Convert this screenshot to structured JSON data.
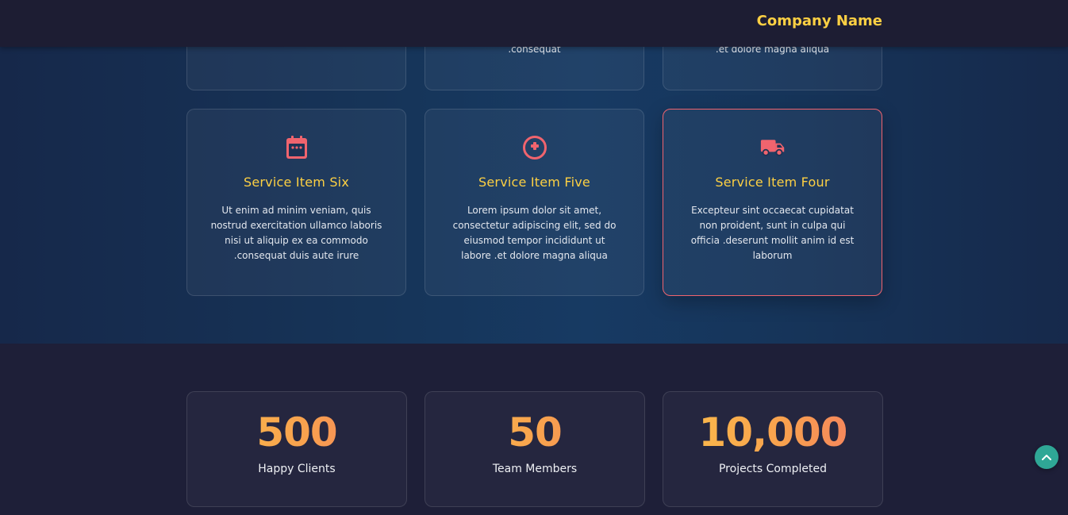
{
  "header": {
    "brand": "Company Name"
  },
  "services_top_partial": [
    {
      "desc_tail": ""
    },
    {
      "desc_tail": ".consequat"
    },
    {
      "desc_tail": ".et dolore magna aliqua"
    }
  ],
  "services": [
    {
      "icon": "calendar-icon",
      "title": "Service Item Six",
      "description": "Ut enim ad minim veniam, quis nostrud exercitation ullamco laboris nisi ut aliquip ex ea commodo .consequat duis aute irure"
    },
    {
      "icon": "plus-circle-icon",
      "title": "Service Item Five",
      "description": "Lorem ipsum dolor sit amet, consectetur adipiscing elit, sed do eiusmod tempor incididunt ut labore .et dolore magna aliqua"
    },
    {
      "icon": "truck-icon",
      "title": "Service Item Four",
      "description": "Excepteur sint occaecat cupidatat non proident, sunt in culpa qui officia .deserunt mollit anim id est laborum"
    }
  ],
  "stats": [
    {
      "value": "500",
      "label": "Happy Clients"
    },
    {
      "value": "50",
      "label": "Team Members"
    },
    {
      "value": "10,000",
      "label": "Projects Completed"
    }
  ],
  "colors": {
    "accent": "#fdd043",
    "icon": "#f0646e",
    "scroll_top": "#2fa796"
  },
  "scroll_top": {
    "icon": "chevron-up-icon"
  }
}
